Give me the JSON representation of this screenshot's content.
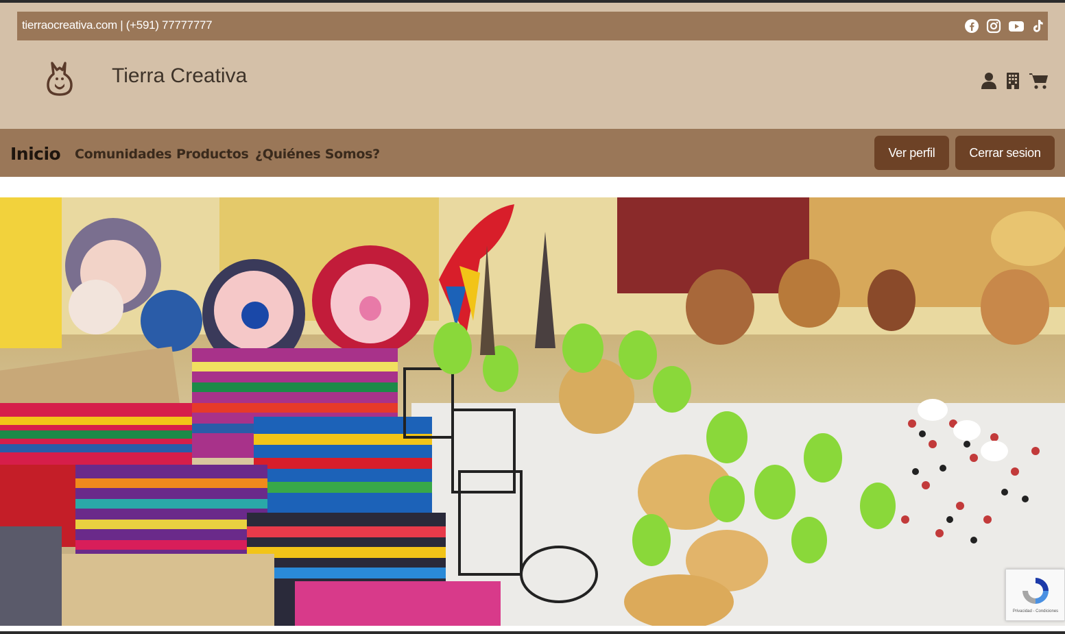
{
  "topbar": {
    "contact": "tierraocreativa.com | (+591) 77777777",
    "social_icons": [
      "facebook-icon",
      "instagram-icon",
      "youtube-icon",
      "tiktok-icon"
    ]
  },
  "header": {
    "brand": "Tierra Creativa",
    "logo_icon": "llama-logo-icon",
    "user_icons": [
      "user-icon",
      "building-icon",
      "cart-icon"
    ]
  },
  "nav": {
    "home": "Inicio",
    "links": [
      "Comunidades",
      "Productos",
      "¿Quiénes Somos?"
    ],
    "profile_button": "Ver perfil",
    "logout_button": "Cerrar sesion"
  },
  "hero": {
    "image_icon": "handicrafts-market-photo"
  },
  "recaptcha": {
    "terms": "Privacidad - Condiciones",
    "icon": "recaptcha-icon"
  },
  "colors": {
    "header_bg": "#d4c0a8",
    "bar_bg": "#9a7758",
    "button_bg": "#6d4226",
    "text_dark": "#3e3329"
  }
}
